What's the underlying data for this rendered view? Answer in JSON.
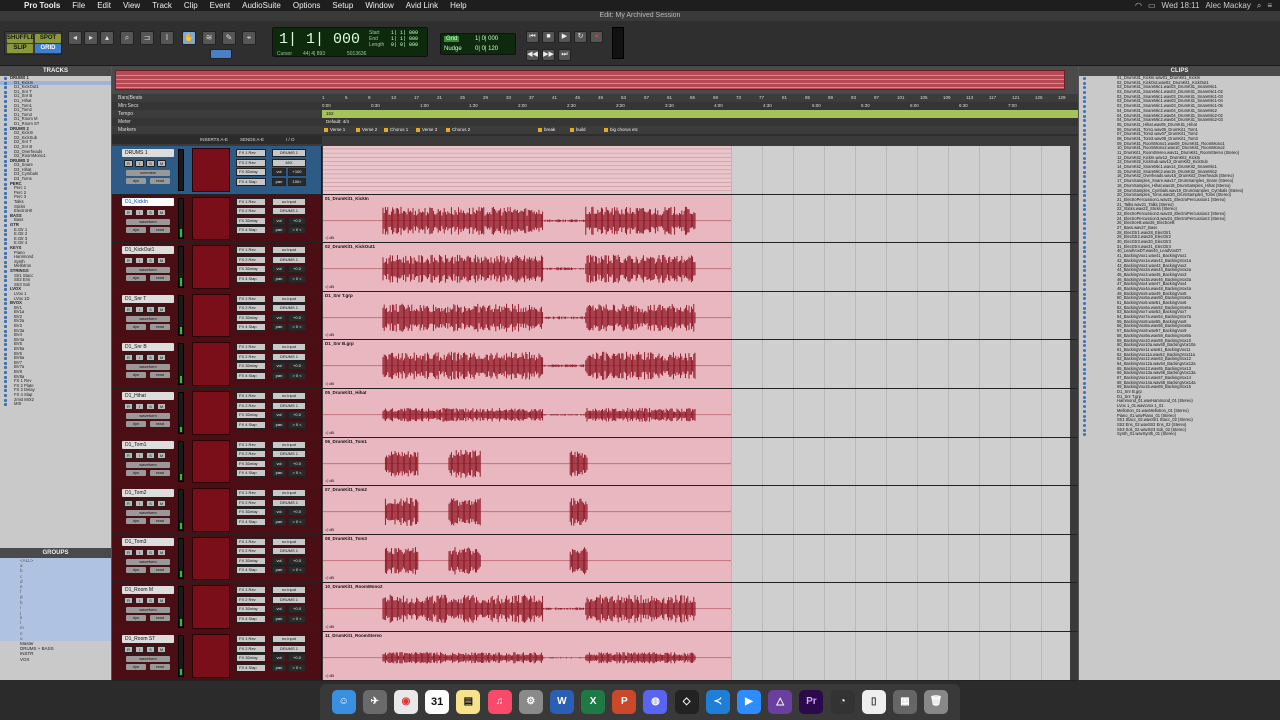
{
  "menubar": {
    "app_name": "Pro Tools",
    "menus": [
      "File",
      "Edit",
      "View",
      "Track",
      "Clip",
      "Event",
      "AudioSuite",
      "Options",
      "Setup",
      "Window",
      "Avid Link",
      "Help"
    ],
    "clock": "Wed 18:11",
    "user": "Alec Mackay"
  },
  "window": {
    "title": "Edit: My Archived Session"
  },
  "toolbar": {
    "modes": [
      "SHUFFLE",
      "SPOT",
      "SLIP",
      "GRID"
    ],
    "counter": {
      "main": "1| 1| 000",
      "start_label": "Start",
      "start_value": "1| 1| 000",
      "end_label": "End",
      "end_value": "1| 1| 000",
      "length_label": "Length",
      "length_value": "0| 0| 000",
      "cursor_label": "Cursor",
      "cursor_value": "44| 4| 893",
      "sample_value": "5013636"
    },
    "grid": {
      "label": "Grid",
      "value": "1| 0| 000"
    },
    "nudge": {
      "label": "Nudge",
      "value": "0| 0| 120"
    }
  },
  "tracks_pane": {
    "header": "TRACKS",
    "items": [
      "DRUMS 1",
      "D1_KickIn",
      "D1_KickOut1",
      "D1_Snr T",
      "D1_Snr B",
      "D1_Hihat",
      "D1_Tom1",
      "D1_Tom2",
      "D1_Tom3",
      "D1_Room M",
      "D1_Room ST",
      "DRUMS 2",
      "D2_KickIn",
      "D2_KickSub",
      "D2_Snr T",
      "D2_Snr B",
      "D2_Overheads",
      "D2_RoomMono1",
      "DRUMS 3",
      "D3_Snare",
      "D3_Hihat",
      "D3_Cymbals",
      "D3_Toms",
      "PERC",
      "Perc 1",
      "Perc 2",
      "Perc 3",
      "Talks",
      "Sticks",
      "ElectroHit",
      "BASS",
      "Bass",
      "GTR",
      "E.Gtr 1",
      "E.Gtr 2",
      "E.Gtr 3",
      "E.Gtr 4",
      "KEYS",
      "Piano",
      "Hammond",
      "Synth",
      "Mellotron",
      "STRINGS",
      "Str1 Stacc",
      "Str2 Ens",
      "Str3 Soli",
      "LVOX",
      "LVox 1",
      "LVox 1D",
      "BVOX",
      "BV1",
      "BV1a",
      "BV2",
      "BV2a",
      "BV3",
      "BV3a",
      "BV4",
      "BV4a",
      "BV5",
      "BV5a",
      "BV6",
      "BV6a",
      "BV7",
      "BV7a",
      "BV8",
      "BV8a",
      "FX 1 Rev",
      "FX 2 Plate",
      "FX 3 Delay",
      "FX 4 Slap",
      "2mst MIX2",
      "MIX"
    ]
  },
  "groups_pane": {
    "header": "GROUPS",
    "items": [
      "<ALL>",
      "a",
      "b",
      "c",
      "d",
      "e",
      "f",
      "g",
      "h",
      "i",
      "j",
      "k",
      "l",
      "m",
      "n",
      "o",
      "Master",
      "DRUMS + BASS",
      "INSTR",
      "VOX"
    ]
  },
  "rulers": {
    "bars_label": "Bars|Beats",
    "minsec_label": "Min:Secs",
    "tempo_label": "Tempo",
    "meter_label": "Meter",
    "markers_label": "Markers",
    "bar_ticks": [
      "1",
      "5",
      "9",
      "13",
      "17",
      "21",
      "25",
      "29",
      "33",
      "37",
      "41",
      "45",
      "49",
      "53",
      "57",
      "61",
      "65",
      "69",
      "73",
      "77",
      "81",
      "85",
      "89",
      "93",
      "97",
      "101",
      "105",
      "109",
      "113",
      "117",
      "121",
      "125",
      "129"
    ],
    "time_ticks": [
      "0:00",
      "0:30",
      "1:00",
      "1:30",
      "2:00",
      "2:30",
      "3:00",
      "3:30",
      "4:00",
      "4:30",
      "5:00",
      "5:30",
      "6:00",
      "6:30",
      "7:00"
    ],
    "tempo_value": "152",
    "meter_value": "Default: 4/4",
    "markers": [
      "Verse 1",
      "Verse 2",
      "Chorus 1",
      "Verse 3",
      "Chorus 2",
      "break",
      "build",
      "big chorus etc"
    ]
  },
  "columns": {
    "inserts": "INSERTS A-E",
    "sends": "SENDS A-E",
    "io": "I / O"
  },
  "tracks": [
    {
      "name": "DRUMS 1",
      "folder": true,
      "sends": [
        "FX 1 Rev",
        "FX 2 Rev",
        "FX 3Delay",
        "FX 4 Slap"
      ],
      "io": [
        "DRUMS 1",
        "MIX",
        "vol",
        "pan"
      ],
      "vol": "+100",
      "pan": "100>",
      "view": "overview",
      "clip": ""
    },
    {
      "name": "D1_KickIn",
      "sends": [
        "FX 1 Rev",
        "FX 2 Rev",
        "FX 3Delay",
        "FX 4 Slap"
      ],
      "io": [
        "no input",
        "DRUMS 1",
        "vol",
        "pan"
      ],
      "vol": "+0.0",
      "pan": "> 0 <",
      "view": "waveform",
      "clip": "01_DrumKit1_KickIn",
      "level": 0.7
    },
    {
      "name": "D1_KickOut1",
      "sends": [
        "FX 1 Rev",
        "FX 2 Rev",
        "FX 3Delay",
        "FX 4 Slap"
      ],
      "io": [
        "no input",
        "DRUMS 1",
        "vol",
        "pan"
      ],
      "vol": "+0.0",
      "pan": "> 0 <",
      "view": "waveform",
      "clip": "02_DrumKit1_KickOut1",
      "level": 0.65
    },
    {
      "name": "D1_Snr T",
      "sends": [
        "FX 1 Rev",
        "FX 2 Rev",
        "FX 3Delay",
        "FX 4 Slap"
      ],
      "io": [
        "no input",
        "DRUMS 1",
        "vol",
        "pan"
      ],
      "vol": "+0.0",
      "pan": "> 0 <",
      "view": "waveform",
      "clip": "D1_Snr T.grp",
      "level": 0.6
    },
    {
      "name": "D1_Snr B",
      "sends": [
        "FX 1 Rev",
        "FX 2 Rev",
        "FX 3Delay",
        "FX 4 Slap"
      ],
      "io": [
        "no input",
        "DRUMS 1",
        "vol",
        "pan"
      ],
      "vol": "+0.0",
      "pan": "> 0 <",
      "view": "waveform",
      "clip": "D1_Snr B.grp",
      "level": 0.6
    },
    {
      "name": "D1_Hihat",
      "sends": [
        "FX 1 Rev",
        "FX 2 Rev",
        "FX 3Delay",
        "FX 4 Slap"
      ],
      "io": [
        "no input",
        "DRUMS 1",
        "vol",
        "pan"
      ],
      "vol": "+0.0",
      "pan": "> 0 <",
      "view": "waveform",
      "clip": "05_DrumKit1_Hihat",
      "level": 0.4
    },
    {
      "name": "D1_Tom1",
      "sends": [
        "FX 1 Rev",
        "FX 2 Rev",
        "FX 3Delay",
        "FX 4 Slap"
      ],
      "io": [
        "no input",
        "DRUMS 1",
        "vol",
        "pan"
      ],
      "vol": "+0.0",
      "pan": "> 0 <",
      "view": "waveform",
      "clip": "06_DrumKit1_Tom1",
      "level": 0.5
    },
    {
      "name": "D1_Tom2",
      "sends": [
        "FX 1 Rev",
        "FX 2 Rev",
        "FX 3Delay",
        "FX 4 Slap"
      ],
      "io": [
        "no input",
        "DRUMS 1",
        "vol",
        "pan"
      ],
      "vol": "+0.0",
      "pan": "> 0 <",
      "view": "waveform",
      "clip": "07_DrumKit1_Tom2",
      "level": 0.5
    },
    {
      "name": "D1_Tom3",
      "sends": [
        "FX 1 Rev",
        "FX 2 Rev",
        "FX 3Delay",
        "FX 4 Slap"
      ],
      "io": [
        "no input",
        "DRUMS 1",
        "vol",
        "pan"
      ],
      "vol": "+0.0",
      "pan": "> 0 <",
      "view": "waveform",
      "clip": "08_DrumKit1_Tom3",
      "level": 0.5
    },
    {
      "name": "D1_Room M",
      "sends": [
        "FX 1 Rev",
        "FX 2 Rev",
        "FX 3Delay",
        "FX 4 Slap"
      ],
      "io": [
        "no input",
        "DRUMS 1",
        "vol",
        "pan"
      ],
      "vol": "+0.0",
      "pan": "> 0 <",
      "view": "waveform",
      "clip": "10_DrumKit1_RoomMono2",
      "level": 0.6
    },
    {
      "name": "D1_Room ST",
      "sends": [
        "FX 1 Rev",
        "FX 2 Rev",
        "FX 3Delay",
        "FX 4 Slap"
      ],
      "io": [
        "no input",
        "DRUMS 1",
        "vol",
        "pan"
      ],
      "vol": "+0.0",
      "pan": "> 0 <",
      "view": "waveform",
      "clip": "11_DrumKit1_RoomStereo",
      "level": 0.5
    }
  ],
  "clips_pane": {
    "header": "CLIPS",
    "items": [
      "01_DrumKit1_KickIn.wav01_DrumKit1_KickIn",
      "02_DrumKit1_KickOut.wav02_DrumKit1_KickOut1",
      "03_DrumKit1_SnareMic1.wav03_DrumKit1_SnareMic1",
      "03_DrumKit1_SnareMic1.wav03_DrumKit1_SnareMic1-02",
      "03_DrumKit1_SnareMic1.wav03_DrumKit1_SnareMic1-03",
      "03_DrumKit1_SnareMic1.wav03_DrumKit1_SnareMic1-04",
      "03_DrumKit1_SnareMic1.wav03_DrumKit1_SnareMic1-05",
      "04_DrumKit1_SnareMic2.wav04_DrumKit1_SnareMic2",
      "04_DrumKit1_SnareMic2.wav04_DrumKit1_SnareMic2-02",
      "04_DrumKit1_SnareMic2.wav04_DrumKit1_SnareMic2-03",
      "05_DrumKit1_Hihat.wav05_DrumKit1_Hihat",
      "06_DrumKit1_Tom1.wav06_DrumKit1_Tom1",
      "07_DrumKit1_Tom2.wav07_DrumKit1_Tom2",
      "08_DrumKit1_Tom3.wav08_DrumKit1_Tom3",
      "09_DrumKit1_RoomMono1.wav09_DrumKit1_RoomMono1",
      "10_DrumKit1_RoomMono2.wav10_DrumKit1_RoomMono2",
      "11_DrumKit1_RoomStereo.wav11_DrumKit1_RoomStereo (Stereo)",
      "12_DrumKit2_KickIn.wav12_DrumKit2_KickIn",
      "13_DrumKit2_KickSub.wav13_DrumKit2_KickSub",
      "14_DrumKit2_SnareMic1.wav14_DrumKit2_SnareMic1",
      "15_DrumKit2_SnareMic2.wav15_DrumKit2_SnareMic2",
      "16_DrumKit2_Overheads.wav16_DrumKit2_Overheads (Stereo)",
      "17_DrumSamples_Snare.wav17_DrumSamples_Snare (Stereo)",
      "18_DrumSamples_Hihat.wav18_DrumSamples_Hihat (Stereo)",
      "19_DrumSamples_Cymbals.wav19_DrumSamples_Cymbals (Stereo)",
      "20_DrumSamples_Toms.wav20_DrumSamples_Toms (Stereo)",
      "21_ElectroPercussion1.wav21_ElectroPercussion1 (Stereo)",
      "21_Talks.wav21_Talks (Stereo)",
      "22_Sticks.wav22_Sticks (Stereo)",
      "23_ElectroPercussion2.wav23_ElectroPercussion2 (Stereo)",
      "24_ElectroPercussion3.wav24_ElectroPercussion3 (Stereo)",
      "26_ElectroHit.wav26_ElectroHit",
      "27_Bass.wav27_Bass",
      "28_ElecGtr1.wav28_ElecGtr1",
      "29_ElecGtr2.wav29_ElecGtr2",
      "30_ElecGtr3.wav30_ElecGtr3",
      "31_ElecGtr4.wav31_ElecGtr4",
      "40_LeadVoxDT.wav40_LeadVoxDT",
      "41_BackingVox1.wav41_BackingVox1",
      "42_BackingVox1a.wav42_BackingVox1a",
      "43_BackingVox2.wav43_BackingVox2",
      "44_BackingVox2a.wav44_BackingVox2a",
      "45_BackingVox3.wav45_BackingVox3",
      "46_BackingVox3a.wav46_BackingVox3a",
      "47_BackingVox4.wav47_BackingVox4",
      "48_BackingVox4a.wav48_BackingVox4a",
      "49_BackingVox5.wav49_BackingVox5",
      "50_BackingVox5a.wav50_BackingVox5a",
      "51_BackingVox6.wav51_BackingVox6",
      "52_BackingVox6a.wav52_BackingVox6a",
      "53_BackingVox7.wav53_BackingVox7",
      "54_BackingVox7a.wav54_BackingVox7a",
      "55_BackingVox8.wav55_BackingVox8",
      "56_BackingVox8a.wav56_BackingVox8a",
      "57_BackingVox9.wav57_BackingVox9",
      "58_BackingVox9a.wav58_BackingVox9a",
      "59_BackingVox10.wav59_BackingVox10",
      "60_BackingVox10a.wav60_BackingVox10a",
      "61_BackingVox11.wav61_BackingVox11",
      "62_BackingVox11a.wav62_BackingVox11a",
      "63_BackingVox12.wav63_BackingVox12",
      "64_BackingVox12a.wav64_BackingVox12a",
      "65_BackingVox13.wav65_BackingVox13",
      "66_BackingVox13a.wav66_BackingVox13a",
      "67_BackingVox14.wav67_BackingVox14",
      "68_BackingVox14a.wav68_BackingVox14a",
      "69_BackingVox15.wav69_BackingVox15",
      "D1_Snr B.grp",
      "D1_Snr T.grp",
      "Hammond_01.wavHammond_01 (Stereo)",
      "LVox 1_01.wavLVox 1_01",
      "Mellotron_01.wavMellotron_01 (Stereo)",
      "Piano_01.wavPiano_01 (Stereo)",
      "Str1 Stacc_02.wavStr1 Stacc_02 (Stereo)",
      "Str2 Ens_02.wavStr2 Ens_02 (Stereo)",
      "Str3 Soli_02.wavStr3 Soli_02 (Stereo)",
      "Synth_01.wavSynth_01 (Stereo)"
    ]
  },
  "dock": {
    "apps": [
      "Finder",
      "Launchpad",
      "Chrome",
      "Calendar",
      "Notes",
      "Music",
      "System Preferences",
      "Word",
      "Excel",
      "PowerPoint",
      "Discord",
      "Unity",
      "VS Code",
      "Zoom",
      "Pro Tools",
      "Premiere Pro",
      "Activity",
      "Document",
      "Folder",
      "Trash"
    ],
    "calendar_day": "31",
    "colors": {
      "pro_tools": "#6b3fa0",
      "premiere": "#2a0a4a"
    }
  },
  "colors": {
    "track_ctrl": "#4b0e14",
    "clip_bg": "#e8b7bf",
    "wave": "#8b0e1c",
    "folder": "#2e5a86",
    "counter_bg": "#0d2a0d"
  }
}
